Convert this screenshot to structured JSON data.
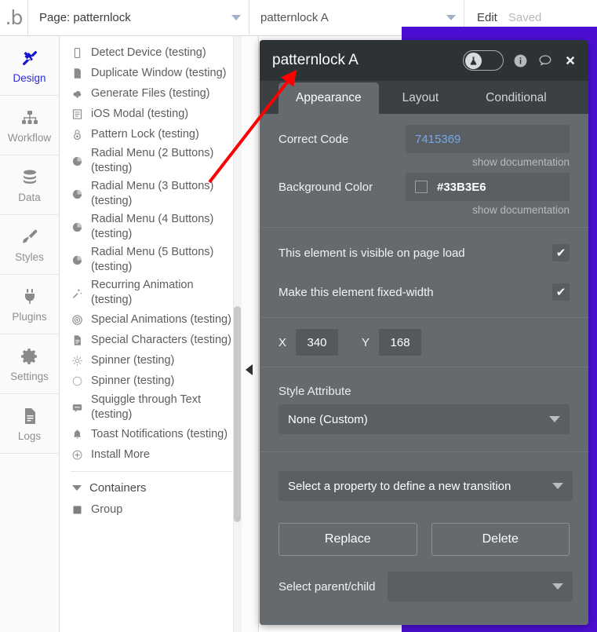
{
  "topbar": {
    "logo": "bubble-logo-icon",
    "page_selector": "Page: patternlock",
    "element_selector": "patternlock A",
    "edit_label": "Edit",
    "saved_label": "Saved"
  },
  "rail": {
    "items": [
      {
        "label": "Design",
        "icon": "design-icon",
        "active": true
      },
      {
        "label": "Workflow",
        "icon": "workflow-icon",
        "active": false
      },
      {
        "label": "Data",
        "icon": "database-icon",
        "active": false
      },
      {
        "label": "Styles",
        "icon": "brush-icon",
        "active": false
      },
      {
        "label": "Plugins",
        "icon": "plug-icon",
        "active": false
      },
      {
        "label": "Settings",
        "icon": "gear-icon",
        "active": false
      },
      {
        "label": "Logs",
        "icon": "document-icon",
        "active": false
      }
    ]
  },
  "element_list": {
    "items": [
      {
        "label": "Detect Device (testing)",
        "icon": "device-icon"
      },
      {
        "label": "Duplicate Window (testing)",
        "icon": "page-icon"
      },
      {
        "label": "Generate Files (testing)",
        "icon": "cloud-download-icon"
      },
      {
        "label": "iOS Modal (testing)",
        "icon": "modal-icon"
      },
      {
        "label": "Pattern Lock (testing)",
        "icon": "lock-icon"
      },
      {
        "label": "Radial Menu (2 Buttons) (testing)",
        "icon": "radial-icon"
      },
      {
        "label": "Radial Menu (3 Buttons) (testing)",
        "icon": "radial-icon"
      },
      {
        "label": "Radial Menu (4 Buttons) (testing)",
        "icon": "radial-icon"
      },
      {
        "label": "Radial Menu (5 Buttons) (testing)",
        "icon": "radial-icon"
      },
      {
        "label": "Recurring Animation (testing)",
        "icon": "wand-icon"
      },
      {
        "label": "Special Animations (testing)",
        "icon": "target-icon"
      },
      {
        "label": "Special Characters (testing)",
        "icon": "document-icon"
      },
      {
        "label": "Spinner (testing)",
        "icon": "sunburst-icon"
      },
      {
        "label": "Spinner (testing)",
        "icon": "circle-icon"
      },
      {
        "label": "Squiggle through Text (testing)",
        "icon": "comment-icon"
      },
      {
        "label": "Toast Notifications (testing)",
        "icon": "bell-icon"
      },
      {
        "label": "Install More",
        "icon": "plus-circle-icon"
      }
    ],
    "group_header": "Containers",
    "group_items": [
      {
        "label": "Group",
        "icon": "square-icon"
      }
    ]
  },
  "property_editor": {
    "title": "patternlock A",
    "header_icons": {
      "test_toggle": "flask-icon",
      "info": "info-icon",
      "comment": "comment-icon",
      "close": "close-icon"
    },
    "tabs": [
      {
        "label": "Appearance",
        "active": true
      },
      {
        "label": "Layout",
        "active": false
      },
      {
        "label": "Conditional",
        "active": false
      }
    ],
    "fields": [
      {
        "label": "Correct Code",
        "value": "7415369",
        "doc_link": "show documentation",
        "kind": "text"
      },
      {
        "label": "Background Color",
        "value": "#33B3E6",
        "doc_link": "show documentation",
        "kind": "color"
      }
    ],
    "checkboxes": [
      {
        "label": "This element is visible on page load",
        "checked": true
      },
      {
        "label": "Make this element fixed-width",
        "checked": true
      }
    ],
    "position": {
      "x_label": "X",
      "x_value": "340",
      "y_label": "Y",
      "y_value": "168"
    },
    "style_attribute": {
      "label": "Style Attribute",
      "value": "None (Custom)"
    },
    "transition": {
      "value": "Select a property to define a new transition"
    },
    "buttons": {
      "replace": "Replace",
      "delete": "Delete"
    },
    "parent_child": {
      "label": "Select parent/child",
      "value": ""
    }
  },
  "colors": {
    "accent_purple": "#4B0FD4",
    "panel_bg": "#646A6E",
    "panel_header": "#2D3234",
    "tabstrip": "#3A4044",
    "field_bg": "#595F63",
    "value_blue": "#7AA7E8",
    "annotation_red": "#FF0000",
    "active_nav_blue": "#2B2BD6"
  }
}
